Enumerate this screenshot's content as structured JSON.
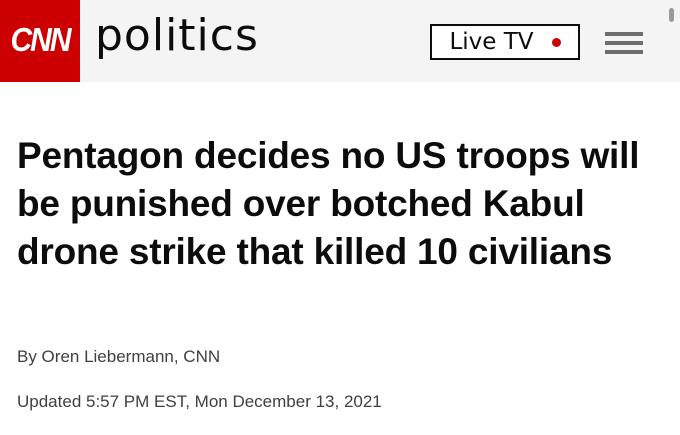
{
  "header": {
    "logo_text": "CNN",
    "section_label": "politics",
    "live_tv_label": "Live TV",
    "menu_icon": "hamburger-menu-icon",
    "brand_color": "#cc0000"
  },
  "article": {
    "headline": "Pentagon decides no US troops will be punished over botched Kabul drone strike that killed 10 civilians",
    "byline": "By Oren Liebermann, CNN",
    "updated": "Updated 5:57 PM EST, Mon December 13, 2021"
  }
}
